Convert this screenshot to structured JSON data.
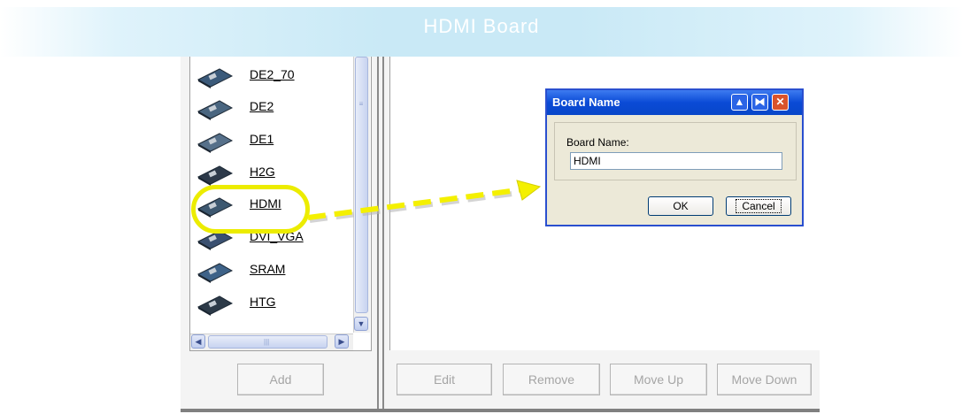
{
  "banner": {
    "title": "HDMI Board"
  },
  "boards": [
    {
      "label": "DE2_70"
    },
    {
      "label": "DE2"
    },
    {
      "label": "DE1"
    },
    {
      "label": "H2G"
    },
    {
      "label": "HDMI"
    },
    {
      "label": "DVI_VGA"
    },
    {
      "label": "SRAM"
    },
    {
      "label": "HTG"
    }
  ],
  "list_buttons": {
    "add": "Add"
  },
  "action_buttons": {
    "edit": "Edit",
    "remove": "Remove",
    "move_up": "Move Up",
    "move_down": "Move Down"
  },
  "dialog": {
    "title": "Board Name",
    "field_label": "Board Name:",
    "field_value": "HDMI",
    "ok": "OK",
    "cancel": "Cancel"
  },
  "colors": {
    "highlight": "#ecec00",
    "dialog_title": "#0a4ad6",
    "banner": "#c9e9f6"
  }
}
